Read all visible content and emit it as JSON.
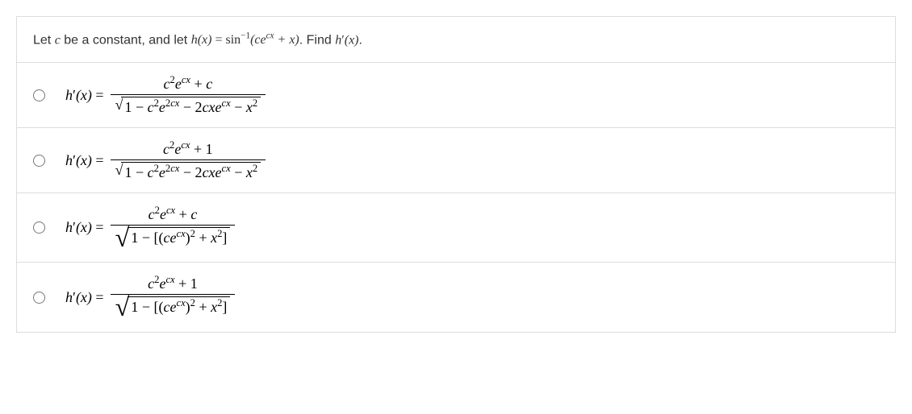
{
  "question": {
    "prefix": "Let ",
    "constant_var": "c",
    "mid1": " be a constant, and let ",
    "function_def": "h(x) = sin⁻¹(ceᶜˣ + x)",
    "mid2": ". Find ",
    "find_expr": "h′(x)",
    "suffix": "."
  },
  "options": [
    {
      "lhs": "h′(x) = ",
      "numerator": "c²eᶜˣ + c",
      "denominator": "√(1 − c²e²ᶜˣ − 2cxeᶜˣ − x²)"
    },
    {
      "lhs": "h′(x) = ",
      "numerator": "c²eᶜˣ + 1",
      "denominator": "√(1 − c²e²ᶜˣ − 2cxeᶜˣ − x²)"
    },
    {
      "lhs": "h′(x) = ",
      "numerator": "c²eᶜˣ + c",
      "denominator": "√(1 − [(ceᶜˣ)² + x²])"
    },
    {
      "lhs": "h′(x) = ",
      "numerator": "c²eᶜˣ + 1",
      "denominator": "√(1 − [(ceᶜˣ)² + x²])"
    }
  ]
}
